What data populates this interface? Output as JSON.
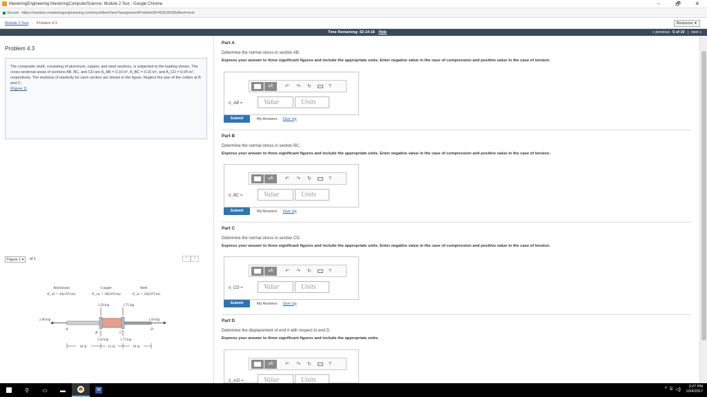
{
  "browser": {
    "window_title": "MasteringEngineering MasteringComputerScience: Module 2 Test - Google Chrome",
    "secure_label": "Secure",
    "url": "https://session.masteringengineering.com/myct/itemView?assignmentProblemID=81816038offset=next",
    "minimize": "–",
    "restore": "🗗",
    "close": "✕"
  },
  "breadcrumb": {
    "module": "Module 2 Test",
    "problem": "Problem 4.3",
    "resources": "Resources ▼"
  },
  "timer": {
    "label": "Time Remaining:",
    "value": "02:14:18",
    "hide": "Hide",
    "previous": "« previous",
    "position": "5 of 10",
    "next": "next »"
  },
  "left": {
    "problem_title": "Problem 4.3",
    "statement": "The composite shaft, consisting of aluminum, copper, and steel sections, is subjected to the loading shown. The cross-sectional areas of sections AB, BC, and CD are A_AB = 0.10 in², A_BC = 0.15 in², and A_CD = 0.04 in², respectively. The modulus of elasticity for each section are shown in the figure. Neglect the size of the collars at B and C.",
    "figure_link": "(Figure 1)",
    "figure_label": "Figure 1",
    "figure_of": "of 1",
    "figure_prev": "<",
    "figure_next": ">",
    "figure": {
      "mat_al": "Aluminum",
      "mat_cu": "Copper",
      "mat_st": "Steel",
      "e_al": "E_al = 10(10³) ksi",
      "e_cu": "E_cu = 18(10³) ksi",
      "e_st": "E_st = 29(10³) ksi",
      "load_left": "2.00 kip",
      "load_b_top": "3.50 kip",
      "load_b_bot": "3.50 kip",
      "load_c_top": "1.75 kip",
      "load_c_bot": "1.75 kip",
      "load_right": "1.50 kip",
      "pt_a": "A",
      "pt_b": "B",
      "pt_c": "C",
      "pt_d": "D",
      "len_ab": "18 in.",
      "len_bc": "12 in.",
      "len_cd": "16 in."
    }
  },
  "parts": [
    {
      "title": "Part A",
      "question": "Determine the normal stress in section AB.",
      "instructions": "Express your answer to three significant figures and include the appropriate units. Enter negative value in the case of compression and positive value in the case of tension.",
      "variable": "σ_AB =",
      "value_placeholder": "Value",
      "units_placeholder": "Units",
      "submit": "Submit",
      "my_answers": "My Answers",
      "give_up": "Give Up"
    },
    {
      "title": "Part B",
      "question": "Determine the normal stress in section BC.",
      "instructions": "Express your answer to three significant figures and include the appropriate units. Enter negative value in the case of compression and positive value in the case of tension.",
      "variable": "σ_BC =",
      "value_placeholder": "Value",
      "units_placeholder": "Units",
      "submit": "Submit",
      "my_answers": "My Answers",
      "give_up": "Give Up"
    },
    {
      "title": "Part C",
      "question": "Determine the normal stress in section CD.",
      "instructions": "Express your answer to three significant figures and include the appropriate units. Enter negative value in the case of compression and positive value in the case of tension.",
      "variable": "σ_CD =",
      "value_placeholder": "Value",
      "units_placeholder": "Units",
      "submit": "Submit",
      "my_answers": "My Answers",
      "give_up": "Give Up"
    },
    {
      "title": "Part D",
      "question": "Determine the displacement of end A with respect to end D.",
      "instructions": "Express your answer to three significant figures and include the appropriate units.",
      "variable": "δ_A/D =",
      "value_placeholder": "Value",
      "units_placeholder": "Units"
    }
  ],
  "toolbar": {
    "mu": "μÅ",
    "undo": "↶",
    "redo": "↷",
    "reset": "↻",
    "help": "?"
  },
  "taskbar": {
    "time": "3:27 PM",
    "date": "10/4/2017"
  },
  "colors": {
    "accent": "#2a75b8",
    "link": "#1f5ca8",
    "timerbar": "#3a4a5c"
  }
}
